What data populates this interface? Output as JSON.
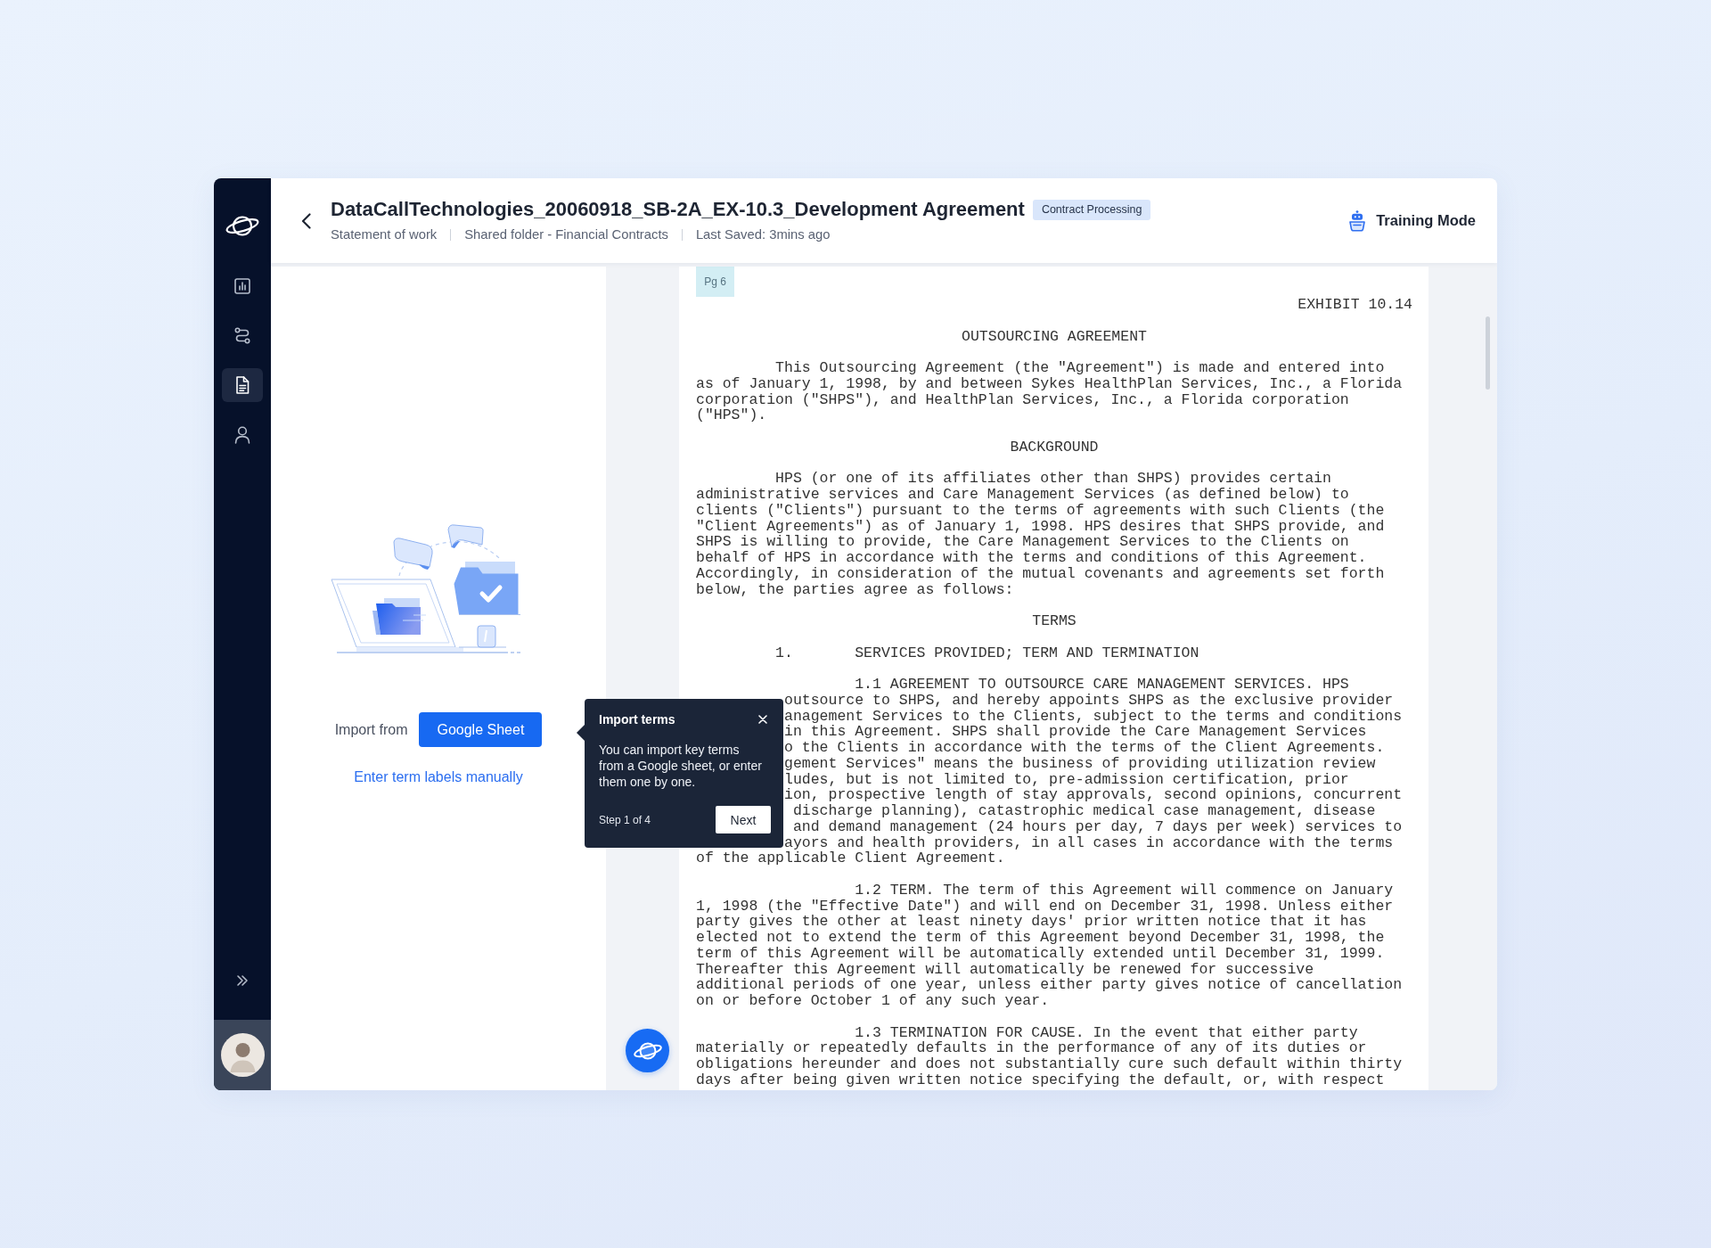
{
  "sidebar": {
    "nav_items": [
      {
        "selected": false
      },
      {
        "selected": false
      },
      {
        "selected": true
      },
      {
        "selected": false
      }
    ]
  },
  "header": {
    "title": "DataCallTechnologies_20060918_SB-2A_EX-10.3_Development Agreement",
    "tag": "Contract Processing",
    "meta": [
      "Statement of work",
      "Shared folder - Financial Contracts",
      "Last Saved: 3mins ago"
    ],
    "training_mode": "Training Mode"
  },
  "import_panel": {
    "label": "Import from",
    "button": "Google Sheet",
    "link": "Enter term labels manually"
  },
  "document": {
    "page_label": "Pg 6",
    "blocks": [
      {
        "kind": "right",
        "text": "EXHIBIT 10.14"
      },
      {
        "kind": "heading",
        "text": "OUTSOURCING AGREEMENT"
      },
      {
        "kind": "paragraph",
        "text": "This Outsourcing Agreement (the \"Agreement\") is made and entered into\nas of January 1, 1998, by and between Sykes HealthPlan Services, Inc., a Florida\ncorporation (\"SHPS\"), and HealthPlan Services, Inc., a Florida corporation\n(\"HPS\")."
      },
      {
        "kind": "heading",
        "text": "BACKGROUND"
      },
      {
        "kind": "paragraph",
        "text": "HPS (or one of its affiliates other than SHPS) provides certain\nadministrative services and Care Management Services (as defined below) to\nclients (\"Clients\") pursuant to the terms of agreements with such Clients (the\n\"Client Agreements\") as of January 1, 1998. HPS desires that SHPS provide, and\nSHPS is willing to provide, the Care Management Services to the Clients on\nbehalf of HPS in accordance with the terms and conditions of this Agreement.\nAccordingly, in consideration of the mutual covenants and agreements set forth\nbelow, the parties agree as follows:"
      },
      {
        "kind": "heading",
        "text": "TERMS"
      },
      {
        "kind": "section",
        "number": "1.",
        "title": "SERVICES PROVIDED; TERM AND TERMINATION"
      },
      {
        "kind": "clause",
        "text": "1.1 AGREEMENT TO OUTSOURCE CARE MANAGEMENT SERVICES. HPS"
      },
      {
        "kind": "fragment",
        "text": "outsource to SHPS, and hereby appoints SHPS as the exclusive provider\nanagement Services to the Clients, subject to the terms and conditions\nin this Agreement. SHPS shall provide the Care Management Services\no the Clients in accordance with the terms of the Client Agreements.\ngement Services\" means the business of providing utilization review\nludes, but is not limited to, pre-admission certification, prior\nion, prospective length of stay approvals, second opinions, concurrent\n discharge planning), catastrophic medical case management, disease\n and demand management (24 hours per day, 7 days per week) services to\nayors and health providers, in all cases in accordance with the terms"
      },
      {
        "kind": "continuation",
        "text": "of the applicable Client Agreement."
      },
      {
        "kind": "clause",
        "text": "1.2 TERM. The term of this Agreement will commence on January\n1, 1998 (the \"Effective Date\") and will end on December 31, 1998. Unless either\nparty gives the other at least ninety days' prior written notice that it has\nelected not to extend the term of this Agreement beyond December 31, 1998, the\nterm of this Agreement will be automatically extended until December 31, 1999.\nThereafter this Agreement will automatically be renewed for successive\nadditional periods of one year, unless either party gives notice of cancellation\non or before October 1 of any such year."
      },
      {
        "kind": "clause",
        "text": "1.3 TERMINATION FOR CAUSE. In the event that either party\nmaterially or repeatedly defaults in the performance of any of its duties or\nobligations hereunder and does not substantially cure such default within thirty\ndays after being given written notice specifying the default, or, with respect"
      }
    ]
  },
  "tooltip": {
    "title": "Import terms",
    "body": "You can import key terms\nfrom a Google sheet, or enter\nthem one by one.",
    "step": "Step 1 of 4",
    "button": "Next"
  }
}
